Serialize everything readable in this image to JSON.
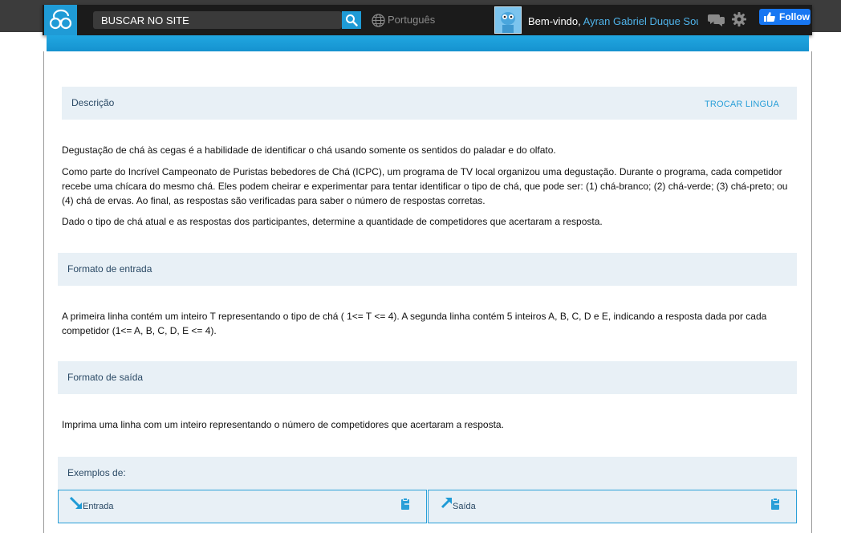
{
  "header": {
    "search_placeholder": "BUSCAR NO SITE",
    "language": "Português",
    "welcome_prefix": "Bem-vindo,",
    "user_name": "Ayran Gabriel Duque Sou...",
    "follow_label": "Follow"
  },
  "description": {
    "heading": "Descrição",
    "change_language": "TROCAR LINGUA",
    "paragraphs": [
      "Degustação de chá às cegas é a habilidade de identificar o chá usando somente os sentidos do paladar e do olfato.",
      "Como parte do Incrível Campeonato de Puristas bebedores de Chá (ICPC), um programa de TV local organizou uma degustação. Durante o programa, cada competidor recebe uma chícara do mesmo chá. Eles podem cheirar e experimentar para tentar identificar o tipo de chá, que pode ser: (1) chá-branco; (2) chá-verde; (3) chá-preto; ou (4) chá de ervas. Ao final, as respostas são verificadas para saber o número de respostas corretas.",
      "Dado o tipo de chá atual e as respostas dos participantes, determine a quantidade de competidores que acertaram a resposta."
    ]
  },
  "input_format": {
    "heading": "Formato de entrada",
    "text": "A primeira linha contém um inteiro T representando o tipo de chá ( 1<= T <= 4). A segunda linha contém 5 inteiros A, B, C, D e E, indicando a resposta dada por cada competidor (1<= A, B, C, D, E <= 4)."
  },
  "output_format": {
    "heading": "Formato de saída",
    "text": "Imprima uma linha com um inteiro representando o número de competidores que acertaram a resposta."
  },
  "examples": {
    "heading": "Exemplos de:",
    "input_label": "Entrada",
    "output_label": "Saída"
  },
  "colors": {
    "accent": "#1f9bd6",
    "topbar": "#1b1b1b",
    "section_bg": "#e8f0f6",
    "link": "#2a9fd8"
  },
  "icons": [
    "site-logo-icon",
    "search-icon",
    "globe-icon",
    "avatar",
    "messages-icon",
    "gear-icon",
    "facebook-like-icon",
    "input-arrow-icon",
    "output-arrow-icon",
    "copy-clipboard-icon"
  ]
}
